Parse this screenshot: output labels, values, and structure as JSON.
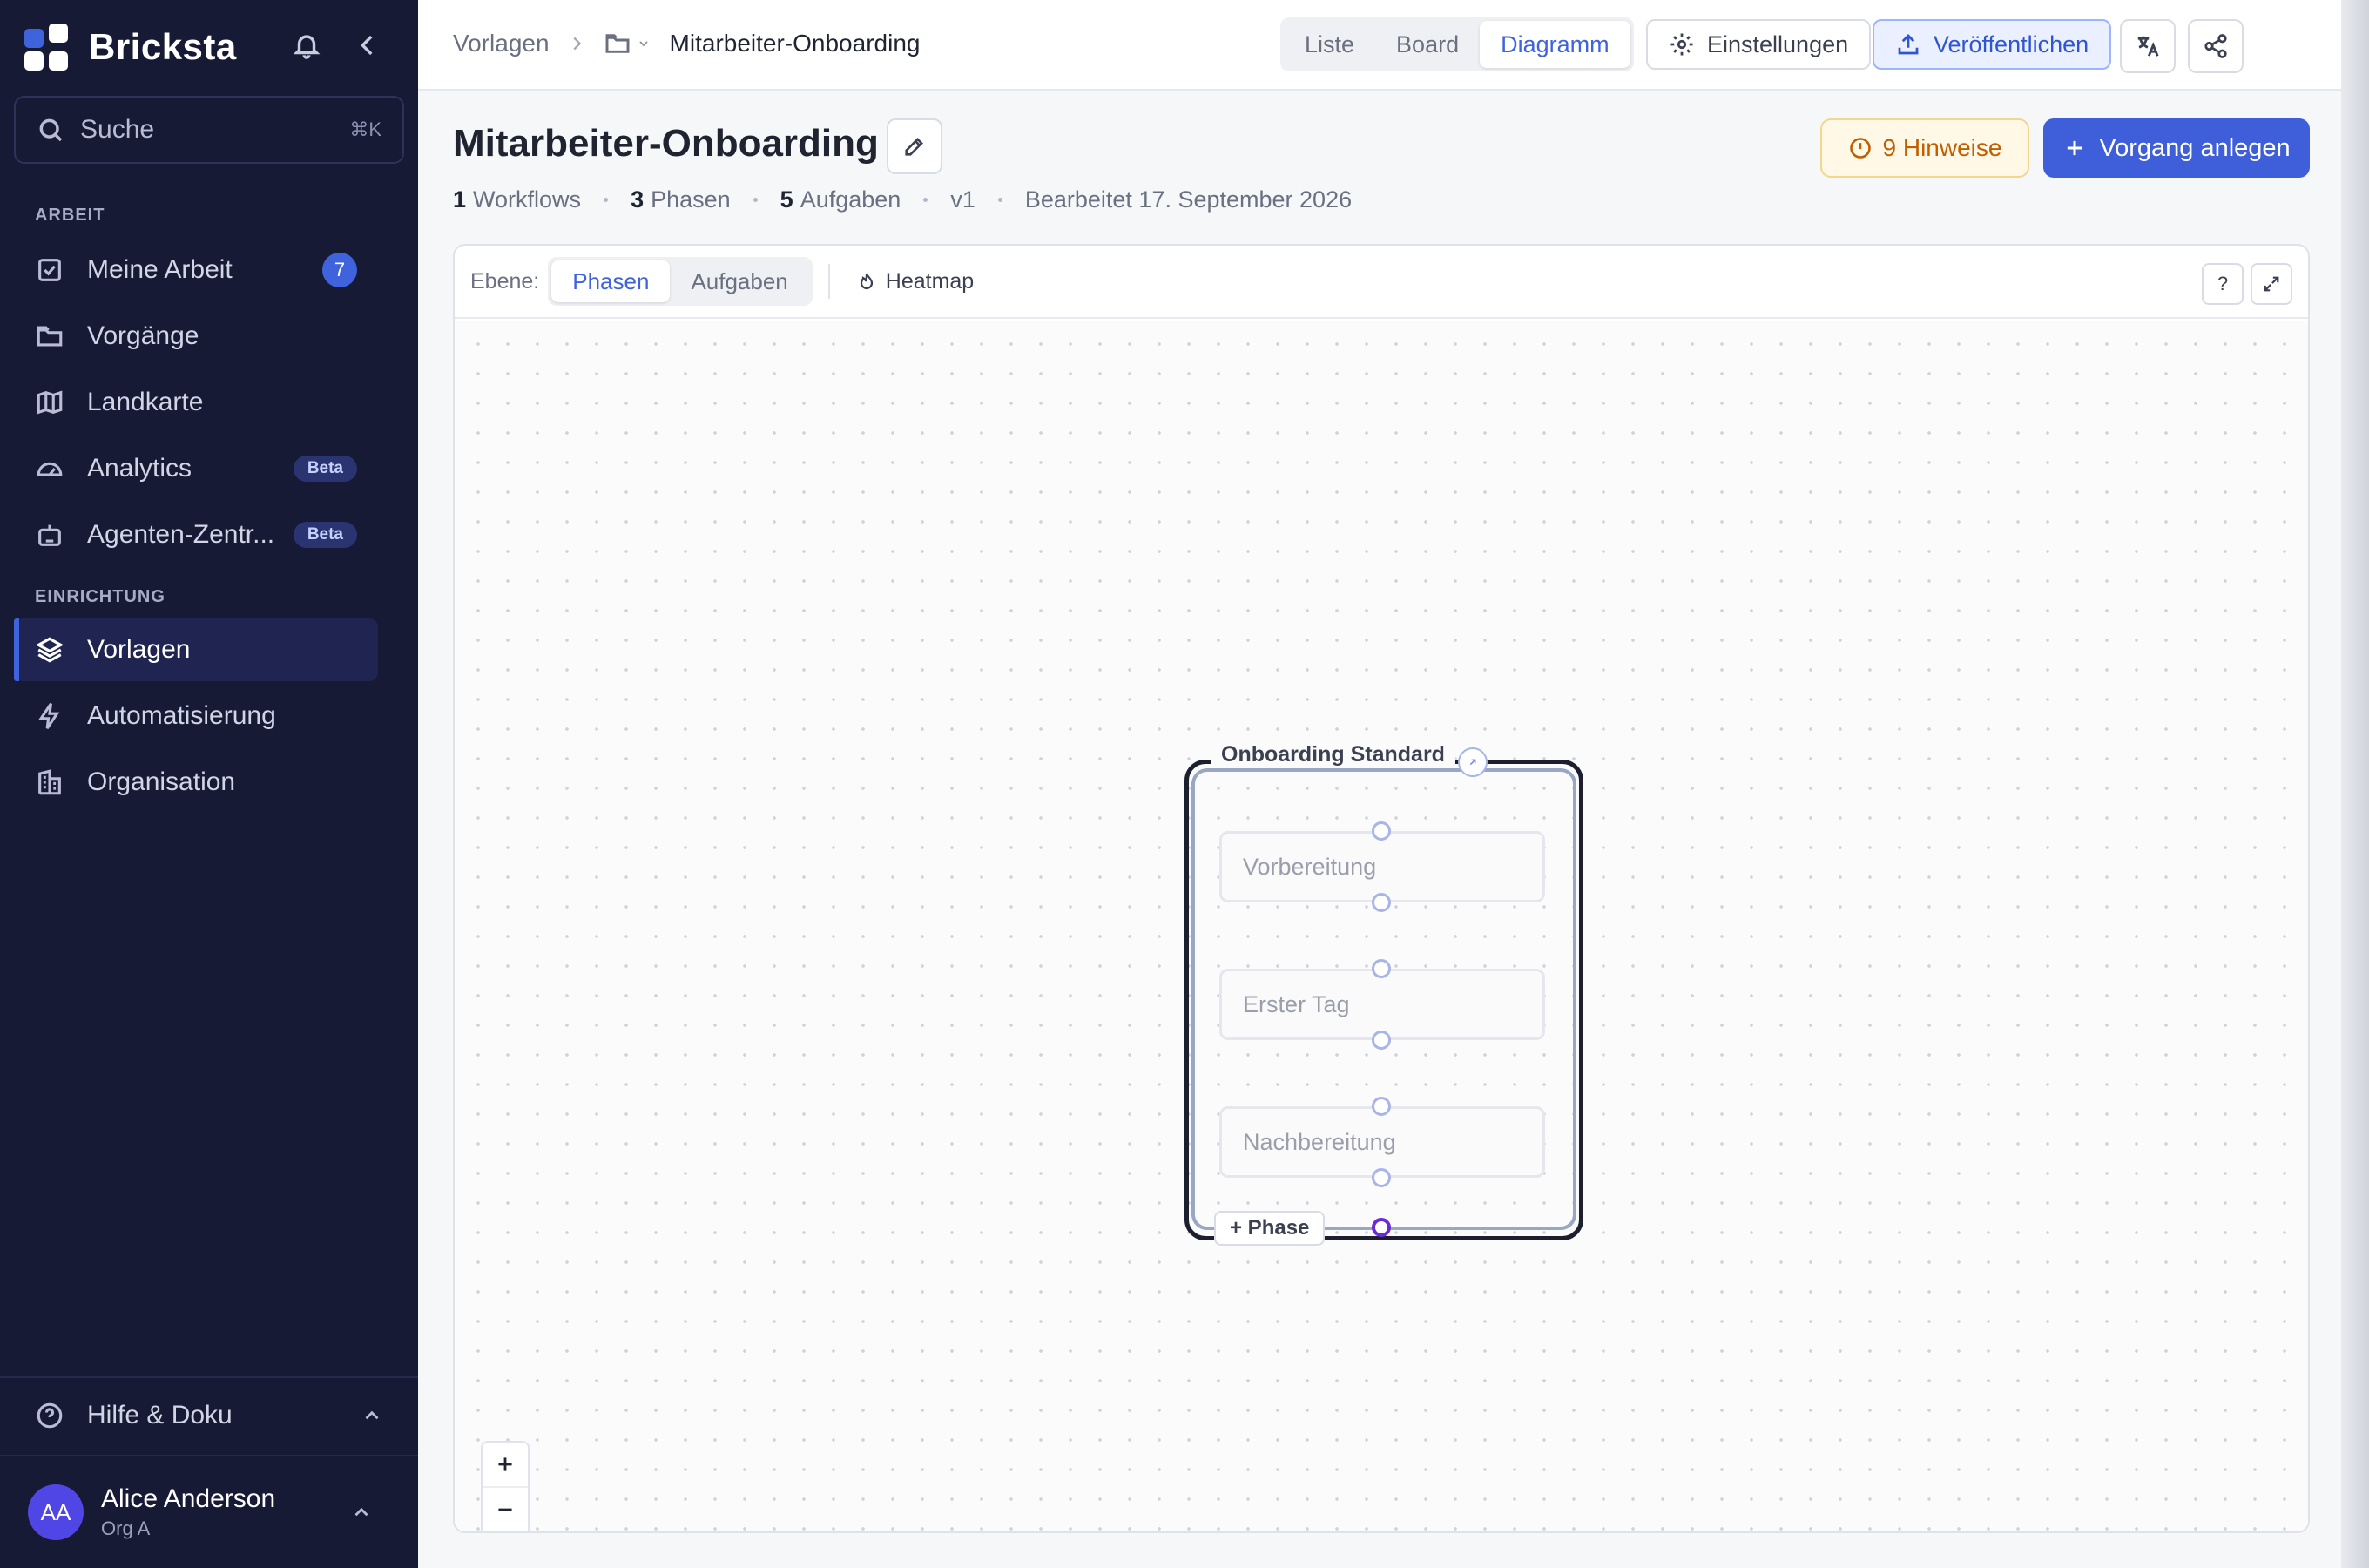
{
  "app": {
    "name": "Bricksta",
    "search_placeholder": "Suche",
    "search_shortcut": "⌘K"
  },
  "sidebar": {
    "sections": [
      {
        "label": "ARBEIT",
        "items": [
          {
            "label": "Meine Arbeit",
            "icon": "checkbox-icon",
            "badge": "7"
          },
          {
            "label": "Vorgänge",
            "icon": "folder-icon"
          },
          {
            "label": "Landkarte",
            "icon": "map-icon"
          },
          {
            "label": "Analytics",
            "icon": "gauge-icon",
            "tag": "Beta"
          },
          {
            "label": "Agenten-Zentr...",
            "icon": "robot-icon",
            "tag": "Beta"
          }
        ]
      },
      {
        "label": "EINRICHTUNG",
        "items": [
          {
            "label": "Vorlagen",
            "icon": "layers-icon",
            "active": true
          },
          {
            "label": "Automatisierung",
            "icon": "lightning-icon"
          },
          {
            "label": "Organisation",
            "icon": "building-icon"
          }
        ]
      }
    ],
    "help_label": "Hilfe & Doku",
    "user": {
      "initials": "AA",
      "name": "Alice Anderson",
      "org": "Org A"
    }
  },
  "topbar": {
    "breadcrumb": {
      "root": "Vorlagen",
      "current": "Mitarbeiter-Onboarding"
    },
    "views": [
      "Liste",
      "Board",
      "Diagramm"
    ],
    "active_view": "Diagramm",
    "settings_label": "Einstellungen",
    "publish_label": "Veröffentlichen"
  },
  "page": {
    "title": "Mitarbeiter-Onboarding",
    "meta": {
      "workflows_count": "1",
      "workflows_label": "Workflows",
      "phases_count": "3",
      "phases_label": "Phasen",
      "tasks_count": "5",
      "tasks_label": "Aufgaben",
      "version": "v1",
      "edited": "Bearbeitet 17. September 2026"
    },
    "hints_label": "9 Hinweise",
    "create_label": "Vorgang anlegen"
  },
  "canvas": {
    "level_label": "Ebene:",
    "levels": [
      "Phasen",
      "Aufgaben"
    ],
    "active_level": "Phasen",
    "heatmap_label": "Heatmap",
    "help_label": "?",
    "workflow": {
      "title": "Onboarding Standard",
      "phases": [
        "Vorbereitung",
        "Erster Tag",
        "Nachbereitung"
      ],
      "add_phase_label": "+ Phase"
    }
  },
  "colors": {
    "sidebar_bg": "#161a35",
    "accent": "#3e63dd",
    "warning": "#c05f00"
  }
}
